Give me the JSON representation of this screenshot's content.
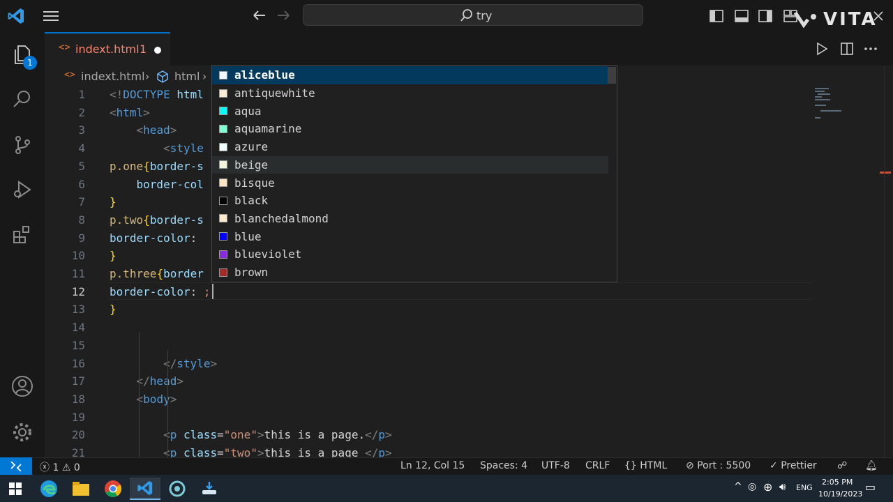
{
  "titlebar": {
    "search_text": "try",
    "watermark": "VITA"
  },
  "tab": {
    "name": "indext.html",
    "problems": "1"
  },
  "breadcrumb": {
    "file": "indext.html",
    "node": "html"
  },
  "activity": {
    "explorer_badge": "1"
  },
  "code_lines": [
    {
      "n": "1",
      "segs": [
        [
          "t-brk",
          "<!"
        ],
        [
          "t-tag",
          "DOCTYPE "
        ],
        [
          "t-attr",
          "html"
        ]
      ]
    },
    {
      "n": "2",
      "segs": [
        [
          "t-brk",
          "<"
        ],
        [
          "t-tag",
          "html"
        ],
        [
          "t-brk",
          ">"
        ]
      ]
    },
    {
      "n": "3",
      "segs": [
        [
          "t-txt",
          "    "
        ],
        [
          "t-brk",
          "<"
        ],
        [
          "t-tag",
          "head"
        ],
        [
          "t-brk",
          ">"
        ]
      ]
    },
    {
      "n": "4",
      "segs": [
        [
          "t-txt",
          "        "
        ],
        [
          "t-brk",
          "<"
        ],
        [
          "t-tag",
          "style"
        ]
      ]
    },
    {
      "n": "5",
      "segs": [
        [
          "t-sel",
          "p.one"
        ],
        [
          "t-y",
          "{"
        ],
        [
          "t-prop",
          "border-s"
        ]
      ]
    },
    {
      "n": "6",
      "segs": [
        [
          "t-txt",
          "    "
        ],
        [
          "t-prop",
          "border-col"
        ]
      ]
    },
    {
      "n": "7",
      "segs": [
        [
          "t-y",
          "}"
        ]
      ]
    },
    {
      "n": "8",
      "segs": [
        [
          "t-sel",
          "p.two"
        ],
        [
          "t-y",
          "{"
        ],
        [
          "t-prop",
          "border-s"
        ]
      ]
    },
    {
      "n": "9",
      "segs": [
        [
          "t-prop",
          "border-color"
        ],
        [
          "t-txt",
          ": "
        ]
      ]
    },
    {
      "n": "10",
      "segs": [
        [
          "t-y",
          "}"
        ]
      ]
    },
    {
      "n": "11",
      "segs": [
        [
          "t-sel",
          "p.three"
        ],
        [
          "t-y",
          "{"
        ],
        [
          "t-prop",
          "border"
        ]
      ]
    },
    {
      "n": "12",
      "segs": [
        [
          "t-prop",
          "border-color"
        ],
        [
          "t-txt",
          ": "
        ],
        [
          "t-str",
          ";"
        ]
      ]
    },
    {
      "n": "13",
      "segs": [
        [
          "t-y",
          "}"
        ]
      ]
    },
    {
      "n": "14",
      "segs": []
    },
    {
      "n": "15",
      "segs": []
    },
    {
      "n": "16",
      "segs": [
        [
          "t-txt",
          "        "
        ],
        [
          "t-brk",
          "</"
        ],
        [
          "t-tag",
          "style"
        ],
        [
          "t-brk",
          ">"
        ]
      ]
    },
    {
      "n": "17",
      "segs": [
        [
          "t-txt",
          "    "
        ],
        [
          "t-brk",
          "</"
        ],
        [
          "t-tag",
          "head"
        ],
        [
          "t-brk",
          ">"
        ]
      ]
    },
    {
      "n": "18",
      "segs": [
        [
          "t-txt",
          "    "
        ],
        [
          "t-brk",
          "<"
        ],
        [
          "t-tag",
          "body"
        ],
        [
          "t-brk",
          ">"
        ]
      ]
    },
    {
      "n": "19",
      "segs": []
    },
    {
      "n": "20",
      "segs": [
        [
          "t-txt",
          "        "
        ],
        [
          "t-brk",
          "<"
        ],
        [
          "t-tag",
          "p "
        ],
        [
          "t-attr",
          "class"
        ],
        [
          "t-txt",
          "="
        ],
        [
          "t-str",
          "\"one\""
        ],
        [
          "t-brk",
          ">"
        ],
        [
          "t-txt",
          "this is a page."
        ],
        [
          "t-brk",
          "</"
        ],
        [
          "t-tag",
          "p"
        ],
        [
          "t-brk",
          ">"
        ]
      ]
    },
    {
      "n": "21",
      "segs": [
        [
          "t-txt",
          "        "
        ],
        [
          "t-brk",
          "<"
        ],
        [
          "t-tag",
          "p "
        ],
        [
          "t-attr",
          "class"
        ],
        [
          "t-txt",
          "="
        ],
        [
          "t-str",
          "\"two\""
        ],
        [
          "t-brk",
          ">"
        ],
        [
          "t-txt",
          "this is a page "
        ],
        [
          "t-brk",
          "</"
        ],
        [
          "t-tag",
          "p"
        ],
        [
          "t-brk",
          ">"
        ]
      ]
    }
  ],
  "suggestions": [
    {
      "label": "aliceblue",
      "color": "#f0f8ff"
    },
    {
      "label": "antiquewhite",
      "color": "#faebd7"
    },
    {
      "label": "aqua",
      "color": "#00ffff"
    },
    {
      "label": "aquamarine",
      "color": "#7fffd4"
    },
    {
      "label": "azure",
      "color": "#f0ffff"
    },
    {
      "label": "beige",
      "color": "#f5f5dc"
    },
    {
      "label": "bisque",
      "color": "#ffe4c4"
    },
    {
      "label": "black",
      "color": "#000000"
    },
    {
      "label": "blanchedalmond",
      "color": "#ffebcd"
    },
    {
      "label": "blue",
      "color": "#0000ff"
    },
    {
      "label": "blueviolet",
      "color": "#8a2be2"
    },
    {
      "label": "brown",
      "color": "#a52a2a"
    }
  ],
  "status": {
    "errors": "1",
    "warnings": "0",
    "position": "Ln 12, Col 15",
    "spaces": "Spaces: 4",
    "encoding": "UTF-8",
    "eol": "CRLF",
    "language": "HTML",
    "port": "Port : 5500",
    "prettier": "Prettier"
  },
  "taskbar": {
    "lang": "ENG",
    "time": "2:05 PM",
    "date": "10/19/2023"
  }
}
